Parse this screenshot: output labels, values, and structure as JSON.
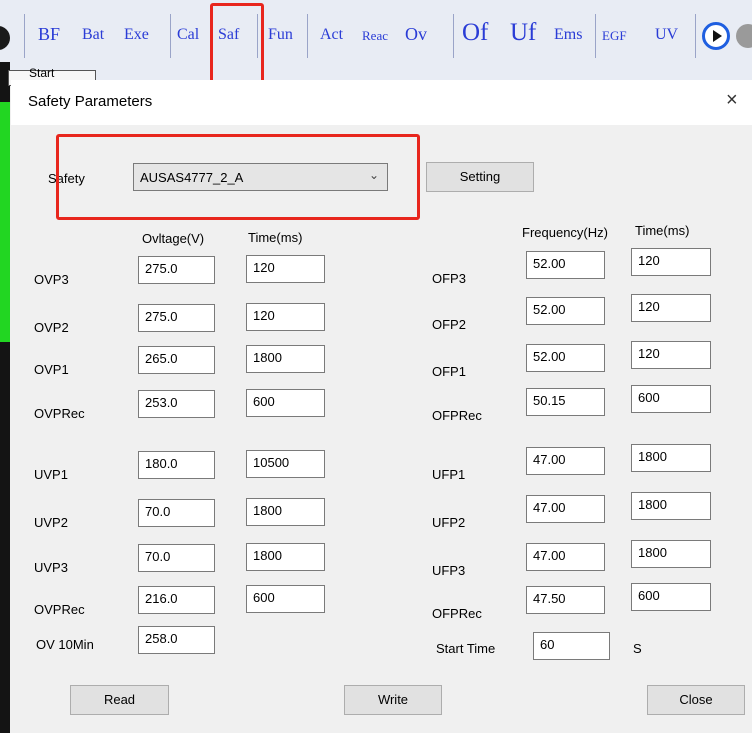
{
  "toolbar": {
    "items": [
      "BF",
      "Bat",
      "Exe",
      "Cal",
      "Saf",
      "Fun",
      "Act",
      "Reac",
      "Ov",
      "Of",
      "Uf",
      "Ems",
      "EGF",
      "UV"
    ]
  },
  "background_tab": "Start",
  "dialog": {
    "title": "Safety Parameters",
    "close_icon": "×",
    "safety_label": "Safety",
    "safety_value": "AUSAS4777_2_A",
    "setting_button": "Setting",
    "voltage_header": "Ovltage(V)",
    "time_header_left": "Time(ms)",
    "frequency_header": "Frequency(Hz)",
    "time_header_right": "Time(ms)",
    "voltage_rows": [
      {
        "label": "OVP3",
        "value": "275.0",
        "time": "120"
      },
      {
        "label": "OVP2",
        "value": "275.0",
        "time": "120"
      },
      {
        "label": "OVP1",
        "value": "265.0",
        "time": "1800"
      },
      {
        "label": "OVPRec",
        "value": "253.0",
        "time": "600"
      },
      {
        "label": "UVP1",
        "value": "180.0",
        "time": "10500"
      },
      {
        "label": "UVP2",
        "value": "70.0",
        "time": "1800"
      },
      {
        "label": "UVP3",
        "value": "70.0",
        "time": "1800"
      },
      {
        "label": "OVPRec",
        "value": "216.0",
        "time": "600"
      }
    ],
    "ov10min_label": "OV 10Min",
    "ov10min_value": "258.0",
    "frequency_rows": [
      {
        "label": "OFP3",
        "value": "52.00",
        "time": "120"
      },
      {
        "label": "OFP2",
        "value": "52.00",
        "time": "120"
      },
      {
        "label": "OFP1",
        "value": "52.00",
        "time": "120"
      },
      {
        "label": "OFPRec",
        "value": "50.15",
        "time": "600"
      },
      {
        "label": "UFP1",
        "value": "47.00",
        "time": "1800"
      },
      {
        "label": "UFP2",
        "value": "47.00",
        "time": "1800"
      },
      {
        "label": "UFP3",
        "value": "47.00",
        "time": "1800"
      },
      {
        "label": "OFPRec",
        "value": "47.50",
        "time": "600"
      }
    ],
    "start_time_label": "Start Time",
    "start_time_value": "60",
    "start_time_unit": "S",
    "read_button": "Read",
    "write_button": "Write",
    "close_button": "Close"
  },
  "colors": {
    "toolbar_text": "#2a3cd6",
    "highlight": "#e8261d",
    "left_strip": "#141414"
  }
}
